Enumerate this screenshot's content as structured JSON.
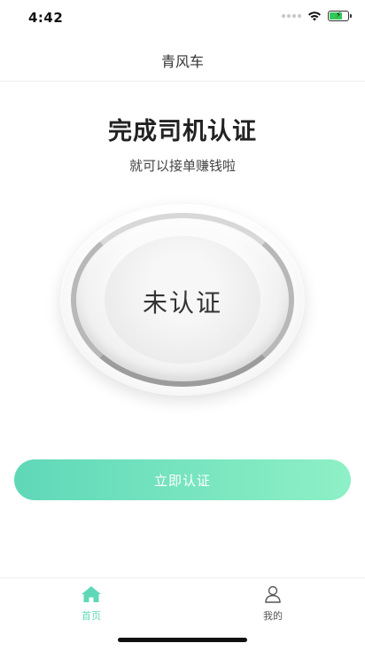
{
  "status_bar": {
    "time": "4:42",
    "icons": [
      "cellular-signal-icon",
      "wifi-icon",
      "battery-charging-icon"
    ],
    "battery_color": "#34c759",
    "battery_level": 0.75
  },
  "nav": {
    "title": "青风车"
  },
  "main": {
    "heading": "完成司机认证",
    "subheading": "就可以接单赚钱啦"
  },
  "status_circle": {
    "label": "未认证"
  },
  "cta": {
    "label": "立即认证",
    "gradient_start": "#5fd8b8",
    "gradient_end": "#8ef0c6"
  },
  "tabs": [
    {
      "label": "首页",
      "icon": "home-icon",
      "active": true,
      "active_color": "#5fd8b8"
    },
    {
      "label": "我的",
      "icon": "person-icon",
      "active": false
    }
  ]
}
